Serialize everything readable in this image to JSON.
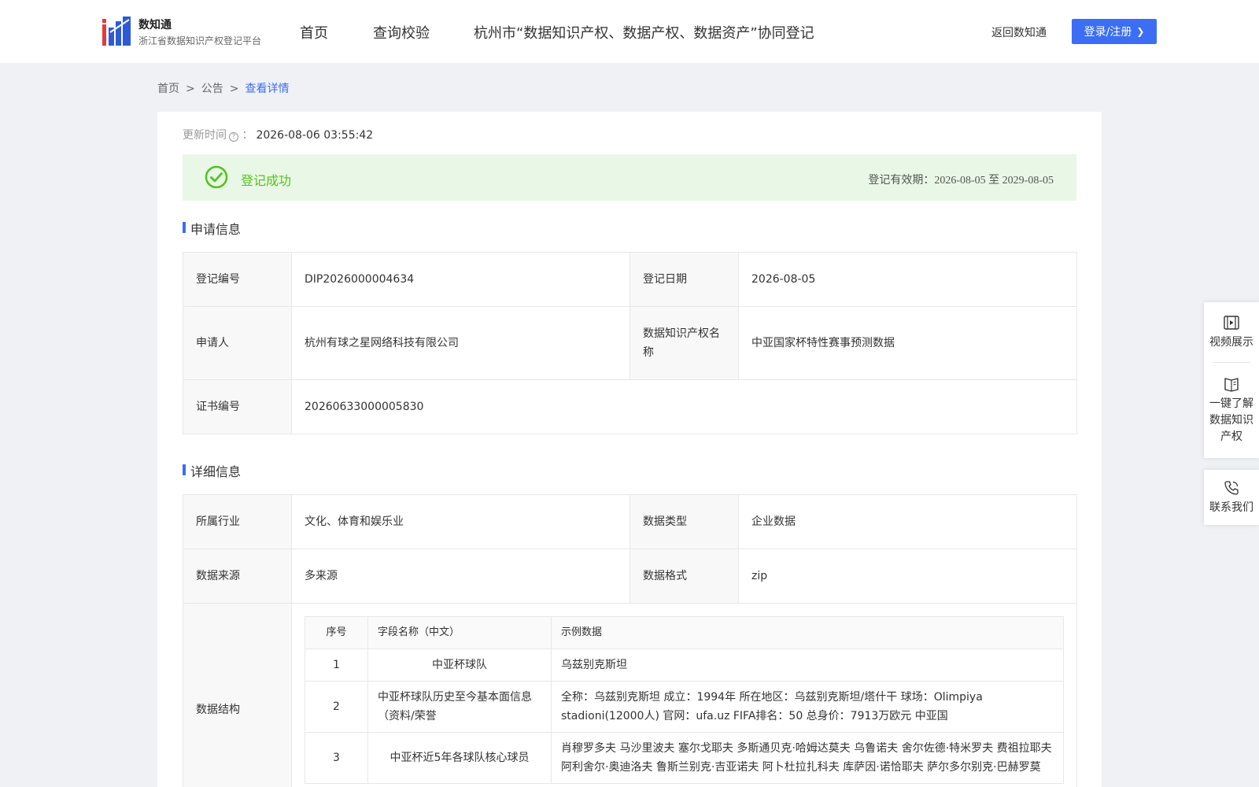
{
  "header": {
    "logo_title": "数知通",
    "logo_subtitle": "浙江省数据知识产权登记平台",
    "nav": [
      "首页",
      "查询校验",
      "杭州市“数据知识产权、数据产权、数据资产”协同登记"
    ],
    "back_link": "返回数知通",
    "login_label": "登录/注册",
    "accent_color": "#3b6ef5"
  },
  "breadcrumb": {
    "items": [
      "首页",
      "公告",
      "查看详情"
    ],
    "separator": ">"
  },
  "update": {
    "label": "更新时间",
    "colon": "：",
    "value": "2026-08-06 03:55:42"
  },
  "banner": {
    "status": "登记成功",
    "validity": "登记有效期：2026-08-05 至 2029-08-05",
    "status_color": "#52c41a"
  },
  "apply_info": {
    "title": "申请信息",
    "reg_no_label": "登记编号",
    "reg_no": "DIP2026000004634",
    "reg_date_label": "登记日期",
    "reg_date": "2026-08-05",
    "applicant_label": "申请人",
    "applicant": "杭州有球之星网络科技有限公司",
    "ip_name_label": "数据知识产权名称",
    "ip_name": "中亚国家杯特性赛事预测数据",
    "cert_no_label": "证书编号",
    "cert_no": "20260633000005830"
  },
  "detail_info": {
    "title": "详细信息",
    "industry_label": "所属行业",
    "industry": "文化、体育和娱乐业",
    "data_type_label": "数据类型",
    "data_type": "企业数据",
    "source_label": "数据来源",
    "source": "多来源",
    "format_label": "数据格式",
    "format": "zip",
    "structure_label": "数据结构",
    "fields": {
      "headers": [
        "序号",
        "字段名称（中文）",
        "示例数据"
      ],
      "rows": [
        {
          "no": "1",
          "name": "中亚杯球队",
          "sample": "乌兹别克斯坦"
        },
        {
          "no": "2",
          "name": "中亚杯球队历史至今基本面信息（资料/荣誉",
          "sample": "全称：乌兹别克斯坦 成立：1994年 所在地区：乌兹别克斯坦/塔什干 球场：Olimpiya stadioni(12000人) 官网：ufa.uz FIFA排名：50 总身价：7913万欧元 中亚国"
        },
        {
          "no": "3",
          "name": "中亚杯近5年各球队核心球员",
          "sample": "肖穆罗多夫 马沙里波夫 塞尔戈耶夫 多斯通贝克·哈姆达莫夫 乌鲁诺夫 舍尔佐德·特米罗夫 费祖拉耶夫 阿利舍尔·奥迪洛夫 鲁斯兰别克·吉亚诺夫 阿卜杜拉扎科夫 库萨因·诺恰耶夫 萨尔多尔别克·巴赫罗莫"
        }
      ]
    }
  },
  "side_panel": {
    "video": "视频展示",
    "know": "一键了解数据知识产权",
    "contact": "联系我们"
  }
}
